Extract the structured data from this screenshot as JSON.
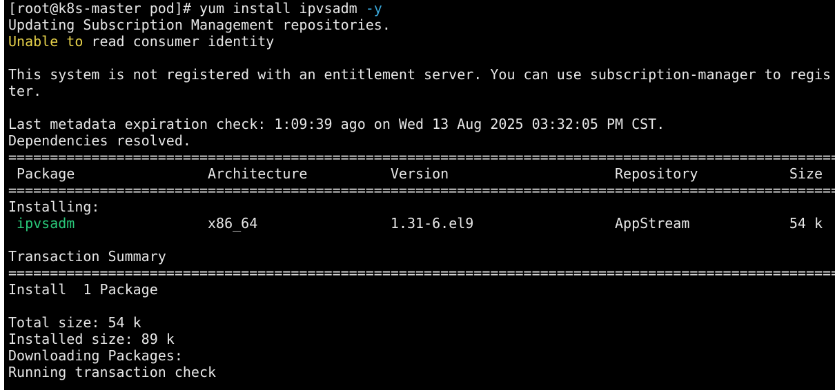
{
  "terminal": {
    "lines": [
      [
        {
          "t": "[root@k8s-master pod]# yum install ipvsadm ",
          "c": "normal"
        },
        {
          "t": "-y",
          "c": "cyan"
        }
      ],
      [
        {
          "t": "Updating Subscription Management repositories.",
          "c": "normal"
        }
      ],
      [
        {
          "t": "Unable to",
          "c": "yellow"
        },
        {
          "t": " read consumer identity",
          "c": "normal"
        }
      ],
      [
        {
          "t": "",
          "c": "normal"
        }
      ],
      [
        {
          "t": "This system is not registered with an entitlement server. You can use subscription-manager to regis",
          "c": "normal"
        }
      ],
      [
        {
          "t": "ter.",
          "c": "normal"
        }
      ],
      [
        {
          "t": "",
          "c": "normal"
        }
      ],
      [
        {
          "t": "Last metadata expiration check: 1:09:39 ago on Wed 13 Aug 2025 03:32:05 PM CST.",
          "c": "normal"
        }
      ],
      [
        {
          "t": "Dependencies resolved.",
          "c": "normal"
        }
      ],
      [
        {
          "t": "====================================================================================================",
          "c": "normal"
        }
      ],
      [
        {
          "t": " Package                Architecture          Version                    Repository           Size",
          "c": "normal"
        }
      ],
      [
        {
          "t": "====================================================================================================",
          "c": "normal"
        }
      ],
      [
        {
          "t": "Installing:",
          "c": "normal"
        }
      ],
      [
        {
          "t": " ",
          "c": "normal"
        },
        {
          "t": "ipvsadm",
          "c": "green"
        },
        {
          "t": "                x86_64                1.31-6.el9                 AppStream            54 k",
          "c": "normal"
        }
      ],
      [
        {
          "t": "",
          "c": "normal"
        }
      ],
      [
        {
          "t": "Transaction Summary",
          "c": "normal"
        }
      ],
      [
        {
          "t": "====================================================================================================",
          "c": "normal"
        }
      ],
      [
        {
          "t": "Install  1 Package",
          "c": "normal"
        }
      ],
      [
        {
          "t": "",
          "c": "normal"
        }
      ],
      [
        {
          "t": "Total size: 54 k",
          "c": "normal"
        }
      ],
      [
        {
          "t": "Installed size: 89 k",
          "c": "normal"
        }
      ],
      [
        {
          "t": "Downloading Packages:",
          "c": "normal"
        }
      ],
      [
        {
          "t": "Running transaction check",
          "c": "normal"
        }
      ]
    ]
  }
}
